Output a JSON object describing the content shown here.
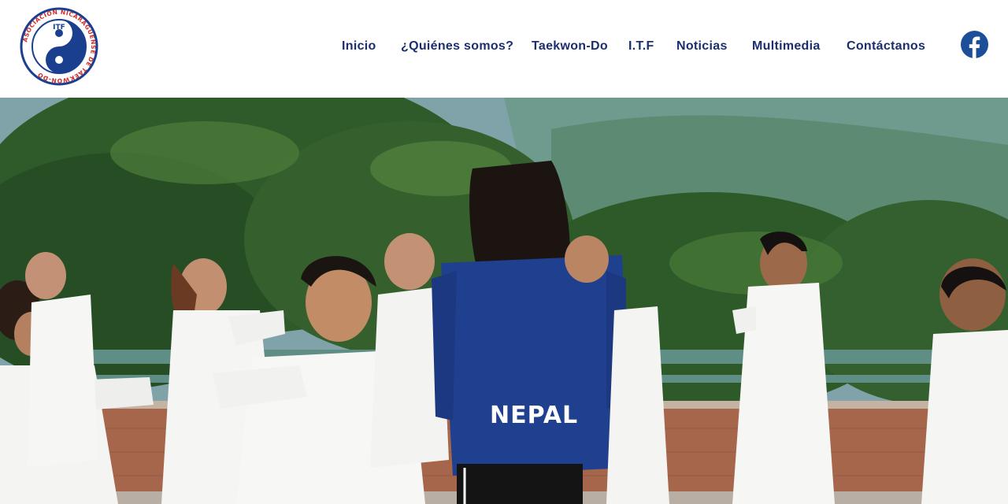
{
  "logo": {
    "text_ring": "ASOCIACION NICARAGUENSE DE TAEKWON-DO",
    "center_mark": "ITF"
  },
  "nav": {
    "items": [
      {
        "label": "Inicio"
      },
      {
        "label": "¿Quiénes somos?"
      },
      {
        "label": "Taekwon-Do"
      },
      {
        "label": "I.T.F"
      },
      {
        "label": "Noticias"
      },
      {
        "label": "Multimedia"
      },
      {
        "label": "Contáctanos"
      }
    ]
  },
  "social": {
    "icon": "facebook-icon"
  },
  "hero": {
    "jacket_text": "NEPAL",
    "colors": {
      "nav_text": "#1b2f6e",
      "facebook": "#1d4e9a",
      "jacket": "#1f3f8f"
    }
  }
}
